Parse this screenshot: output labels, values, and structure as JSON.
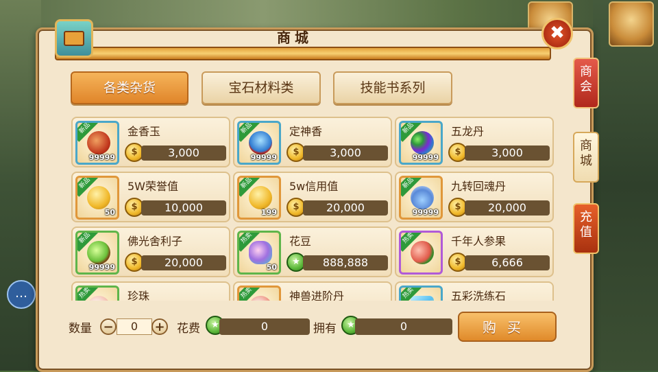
{
  "window": {
    "title": "商城"
  },
  "tabs": [
    {
      "label": "各类杂货",
      "active": true
    },
    {
      "label": "宝石材料类",
      "active": false
    },
    {
      "label": "技能书系列",
      "active": false
    }
  ],
  "side_tabs": [
    {
      "label_top": "商",
      "label_bottom": "会"
    },
    {
      "label_top": "商",
      "label_bottom": "城"
    },
    {
      "label_top": "充",
      "label_bottom": "值"
    }
  ],
  "items": [
    {
      "name": "金香玉",
      "price": "3,000",
      "qty": "99999",
      "badge": "新品",
      "currency": "coin"
    },
    {
      "name": "定神香",
      "price": "3,000",
      "qty": "99999",
      "badge": "新品",
      "currency": "coin"
    },
    {
      "name": "五龙丹",
      "price": "3,000",
      "qty": "99999",
      "badge": "新品",
      "currency": "coin"
    },
    {
      "name": "5W荣誉值",
      "price": "10,000",
      "qty": "50",
      "badge": "新品",
      "currency": "coin"
    },
    {
      "name": "5w信用值",
      "price": "20,000",
      "qty": "199",
      "badge": "新品",
      "currency": "coin"
    },
    {
      "name": "九转回魂丹",
      "price": "20,000",
      "qty": "99999",
      "badge": "新品",
      "currency": "coin"
    },
    {
      "name": "佛光舍利子",
      "price": "20,000",
      "qty": "99999",
      "badge": "新品",
      "currency": "coin"
    },
    {
      "name": "花豆",
      "price": "888,888",
      "qty": "50",
      "badge": "热卖",
      "currency": "jade"
    },
    {
      "name": "千年人参果",
      "price": "6,666",
      "qty": "",
      "badge": "热卖",
      "currency": "coin"
    },
    {
      "name": "珍珠",
      "price": "",
      "qty": "",
      "badge": "热卖",
      "currency": "coin"
    },
    {
      "name": "神兽进阶丹",
      "price": "",
      "qty": "",
      "badge": "热卖",
      "currency": "coin"
    },
    {
      "name": "五彩洗练石",
      "price": "",
      "qty": "",
      "badge": "热卖",
      "currency": "coin"
    }
  ],
  "bottom": {
    "quantity_label": "数量",
    "quantity_value": "0",
    "minus": "−",
    "plus": "+",
    "cost_label": "花费",
    "cost_value": "0",
    "own_label": "拥有",
    "own_value": "0",
    "buy_label": "购买"
  },
  "colors": {
    "panel_bg": "#f4e6cc",
    "accent_orange": "#e0852a",
    "price_bar": "#6a5232",
    "badge_green": "#2e9a3a"
  },
  "icons": {
    "close": "close-icon",
    "chest": "treasure-chest-icon",
    "coin": "gold-coin-icon",
    "jade": "jade-coin-icon",
    "chat": "chat-icon"
  }
}
